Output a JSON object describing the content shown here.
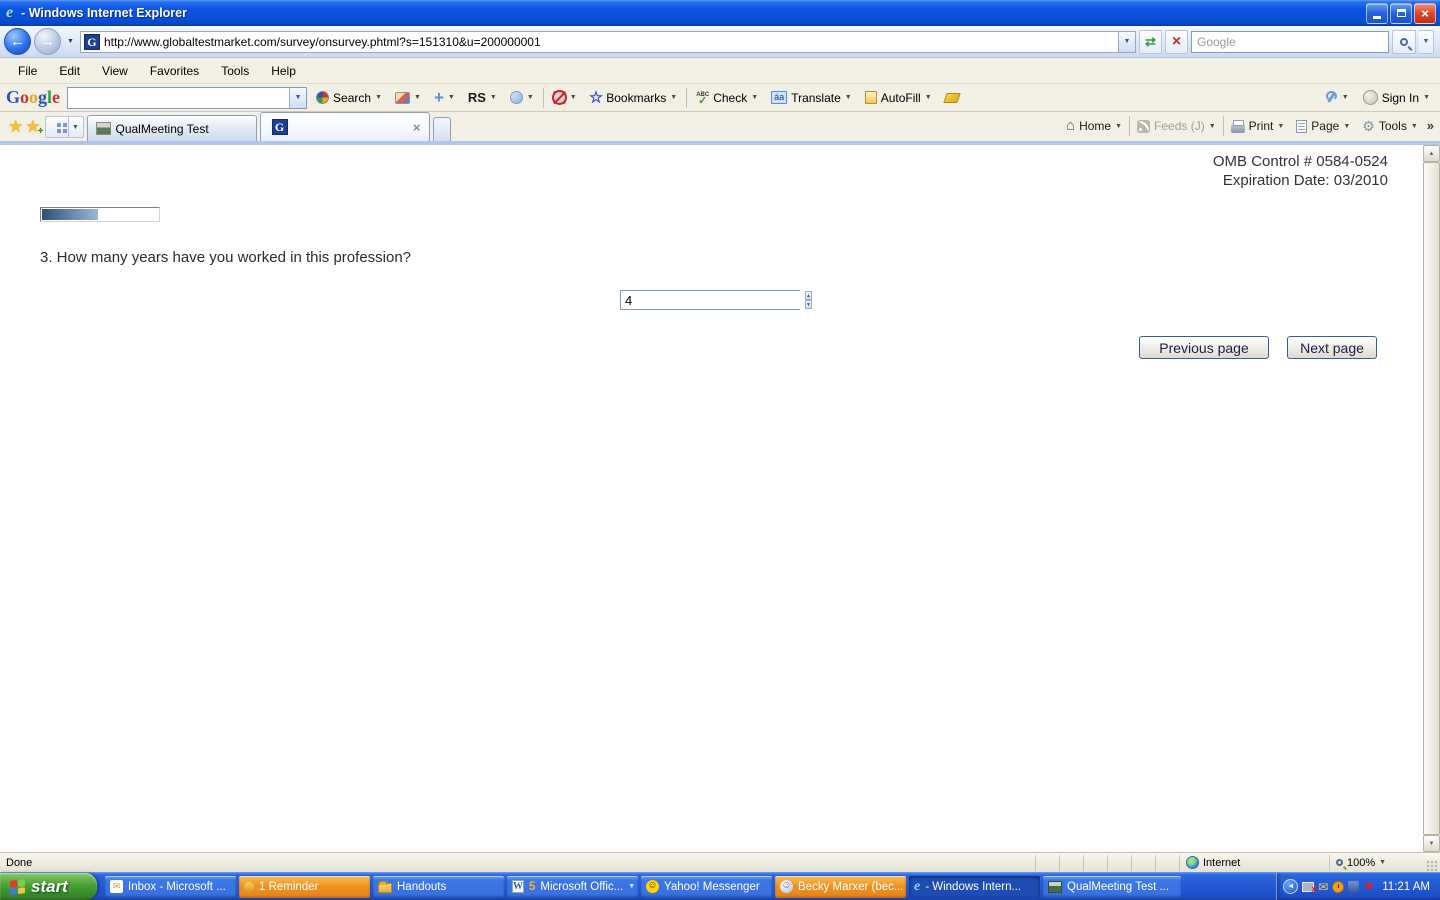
{
  "window": {
    "title": " - Windows Internet Explorer"
  },
  "address_bar": {
    "url": "http://www.globaltestmarket.com/survey/onsurvey.phtml?s=151310&u=200000001",
    "search_placeholder": "Google"
  },
  "menu_bar": {
    "items": [
      "File",
      "Edit",
      "View",
      "Favorites",
      "Tools",
      "Help"
    ]
  },
  "google_toolbar": {
    "logo_letters": [
      "G",
      "o",
      "o",
      "g",
      "l",
      "e"
    ],
    "search_label": "Search",
    "rs_label": "RS",
    "bookmarks_label": "Bookmarks",
    "check_label": "Check",
    "check_abc": "ABC",
    "translate_label": "Translate",
    "translate_glyph": "áa",
    "autofill_label": "AutoFill",
    "sign_in_label": "Sign In"
  },
  "tab_bar": {
    "tabs": [
      {
        "title": "QualMeeting Test"
      },
      {
        "title": ""
      }
    ]
  },
  "command_bar": {
    "items": [
      {
        "label": "Home"
      },
      {
        "label": "Feeds (J)"
      },
      {
        "label": "Print"
      },
      {
        "label": "Page"
      },
      {
        "label": "Tools"
      }
    ]
  },
  "page": {
    "omb_line1": "OMB Control # 0584-0524",
    "omb_line2": "Expiration Date: 03/2010",
    "progress_percent": 48,
    "question": "3. How many years have you worked in this profession?",
    "answer_value": "4",
    "previous_button": "Previous page",
    "next_button": "Next page"
  },
  "status_bar": {
    "status": "Done",
    "zone": "Internet",
    "zoom_level": "100%"
  },
  "taskbar": {
    "start_label": "start",
    "items": [
      {
        "label": "Inbox - Microsoft ..."
      },
      {
        "label": "1 Reminder"
      },
      {
        "label": "Handouts"
      },
      {
        "label": "Microsoft Offic...",
        "count": "5"
      },
      {
        "label": "Yahoo! Messenger"
      },
      {
        "label": "Becky Marxer (bec..."
      },
      {
        "label": " - Windows Intern..."
      },
      {
        "label": "QualMeeting Test ..."
      }
    ],
    "clock": "11:21 AM"
  },
  "icons": {
    "back": "←",
    "forward": "→",
    "dropdown": "▼",
    "refresh": "⇄",
    "stop": "×",
    "close": "×",
    "favicon_g": "G",
    "star": "★",
    "plus": "+",
    "home": "⌂",
    "chevrons": "»",
    "check": "✓",
    "gear": "⚙",
    "up": "▲",
    "down": "▼",
    "envelope": "✉",
    "smiley": "☺",
    "flag": "⚑",
    "word_w": "W",
    "ie_e": "e",
    "tray_chevron": "◄"
  }
}
